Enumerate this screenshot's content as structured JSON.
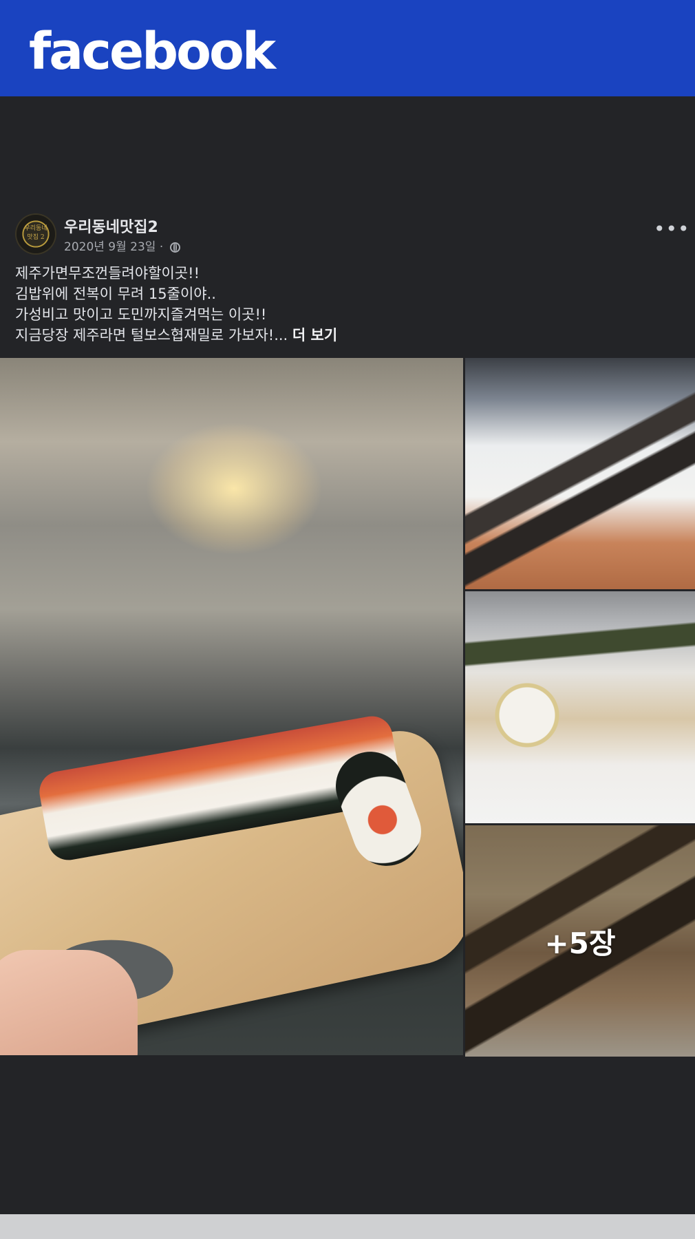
{
  "header": {
    "logo_text": "facebook",
    "brand_color": "#1a43c0"
  },
  "post": {
    "page_name": "우리동네맛집2",
    "avatar_text_line1": "우리동네",
    "avatar_text_line2": "맛집 2",
    "date": "2020년 9월 23일 · ",
    "privacy_icon": "globe-icon",
    "more_icon": "more-horizontal-icon",
    "text_lines": [
      "제주가면무조껀들려야할이곳!!",
      "김밥위에 전복이 무려 15줄이야..",
      "가성비고 맛이고 도민까지즐겨먹는 이곳!!",
      "지금당장 제주라면 털보스협재밀로 가보자!... "
    ],
    "see_more": "더 보기",
    "photos": {
      "main_alt": "sushi roll on wooden board by the sea",
      "extra_count": "+5장"
    }
  },
  "colors": {
    "background": "#232427",
    "text": "#e4e6eb",
    "meta_text": "#a8abb1"
  }
}
